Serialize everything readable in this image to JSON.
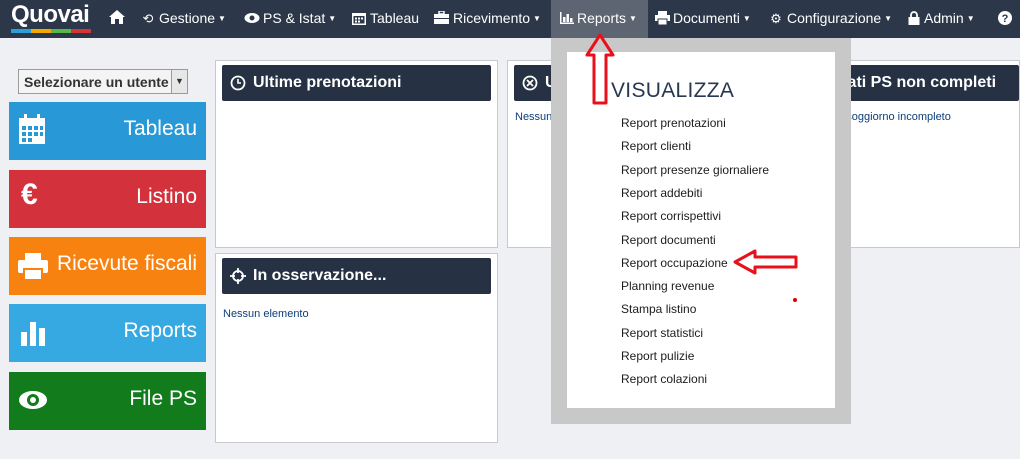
{
  "nav": {
    "logo": "Quovai",
    "logo_colors": [
      "#2aa0da",
      "#f2a900",
      "#54b948",
      "#d5353a"
    ],
    "items": [
      {
        "id": "home",
        "icon": "home-icon",
        "label": ""
      },
      {
        "id": "gestione",
        "icon": "retweet-icon",
        "label": "Gestione"
      },
      {
        "id": "ps",
        "icon": "eye-icon",
        "label": "PS & Istat"
      },
      {
        "id": "tableau",
        "icon": "calendar-icon",
        "label": "Tableau"
      },
      {
        "id": "ricevimento",
        "icon": "briefcase-icon",
        "label": "Ricevimento"
      },
      {
        "id": "reports",
        "icon": "bar-chart-icon",
        "label": "Reports"
      },
      {
        "id": "documenti",
        "icon": "print-icon",
        "label": "Documenti"
      },
      {
        "id": "configurazione",
        "icon": "gear-icon",
        "label": "Configurazione"
      },
      {
        "id": "admin",
        "icon": "lock-icon",
        "label": "Admin"
      },
      {
        "id": "help",
        "icon": "question-icon",
        "label": ""
      }
    ],
    "active": "Reports"
  },
  "user_select": {
    "value": "Selezionare un utente"
  },
  "tiles": [
    {
      "label": "Tableau",
      "color": "#2899d6",
      "icon": "calendar-icon"
    },
    {
      "label": "Listino",
      "color": "#d3313b",
      "icon": "euro-icon"
    },
    {
      "label": "Ricevute fiscali",
      "color": "#f7820f",
      "icon": "printer-icon"
    },
    {
      "label": "Reports",
      "color": "#36a8e2",
      "icon": "bar-chart-icon"
    },
    {
      "label": "File PS",
      "color": "#127c1c",
      "icon": "eye-icon"
    }
  ],
  "panels": {
    "ultime_prenotazioni": {
      "title": "Ultime prenotazioni"
    },
    "in_osservazione": {
      "title": "In osservazione...",
      "message": "Nessun elemento"
    },
    "ultimi": {
      "title": "Ult",
      "message": "Nessuna c"
    },
    "dati_ps": {
      "title": "Dati PS non completi",
      "message": "un soggiorno incompleto"
    }
  },
  "dropdown": {
    "title": "VISUALIZZA",
    "items": [
      "Report prenotazioni",
      "Report clienti",
      "Report presenze giornaliere",
      "Report addebiti",
      "Report corrispettivi",
      "Report documenti",
      "Report occupazione",
      "Planning revenue",
      "Stampa listino",
      "Report statistici",
      "Report pulizie",
      "Report colazioni"
    ]
  },
  "annotation_color": "#e8101a"
}
